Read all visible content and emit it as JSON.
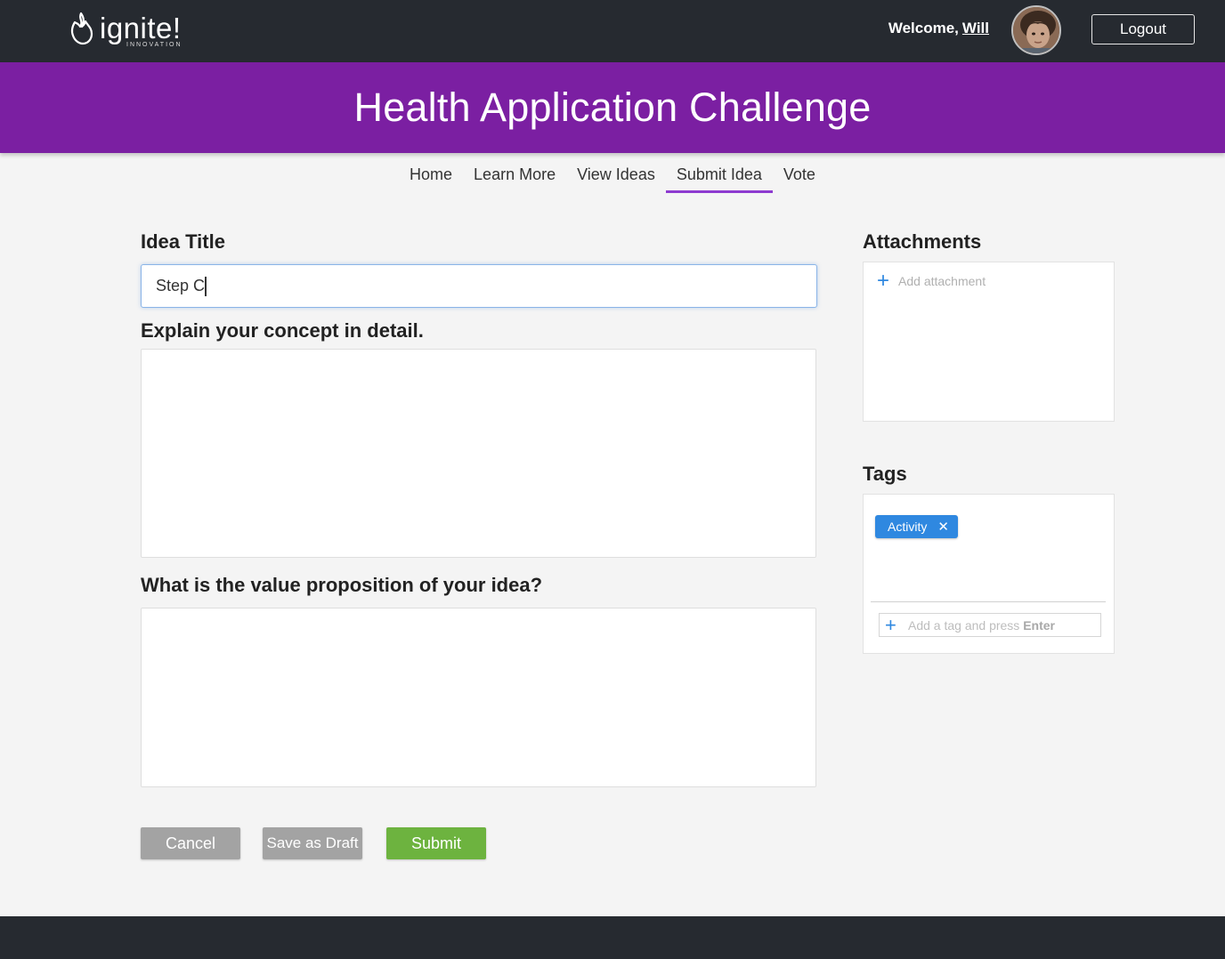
{
  "header": {
    "logo_name": "ignite!",
    "logo_sub": "INNOVATION",
    "welcome_prefix": "Welcome,",
    "user_name": "Will",
    "logout_label": "Logout"
  },
  "banner": {
    "title": "Health Application Challenge"
  },
  "nav": {
    "items": [
      {
        "label": "Home"
      },
      {
        "label": "Learn More"
      },
      {
        "label": "View Ideas"
      },
      {
        "label": "Submit Idea"
      },
      {
        "label": "Vote"
      }
    ],
    "active": "Submit Idea"
  },
  "form": {
    "idea_title_label": "Idea Title",
    "idea_title_value": "Step C",
    "concept_label": "Explain your concept in detail.",
    "concept_value": "",
    "value_prop_label": "What is the value proposition of your idea?",
    "value_prop_value": ""
  },
  "attachments": {
    "heading": "Attachments",
    "add_label": "Add attachment"
  },
  "tags": {
    "heading": "Tags",
    "items": [
      {
        "label": "Activity"
      }
    ],
    "input_hint": "Add a tag and press",
    "input_hint_key": "Enter"
  },
  "actions": {
    "cancel_label": "Cancel",
    "draft_label": "Save as Draft",
    "submit_label": "Submit"
  },
  "colors": {
    "topbar": "#262a30",
    "banner": "#7b1fa2",
    "nav_active_underline": "#8e3bd0",
    "tag_blue": "#2f88e0",
    "submit_green": "#6db33f",
    "secondary_gray": "#a3a3a3"
  },
  "icons": {
    "logo": "flame-icon",
    "add": "plus-icon",
    "remove_tag": "close-icon"
  }
}
